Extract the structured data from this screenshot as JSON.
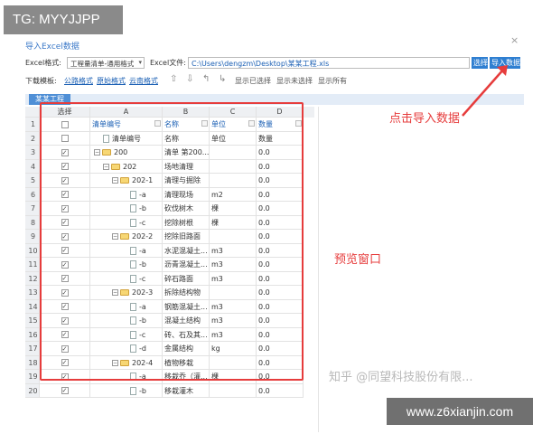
{
  "overlay": {
    "tg_label": "TG: MYYJJPP",
    "site_label": "www.z6xianjin.com",
    "watermark": "知乎 @同望科技股份有限..."
  },
  "dialog": {
    "title": "导入Excel数据",
    "close": "×",
    "excel_format_label": "Excel格式:",
    "excel_format_value": "工程量清单-通用格式",
    "excel_file_label": "Excel文件:",
    "excel_file_value": "C:\\Users\\dengzm\\Desktop\\某某工程.xls",
    "select_button": "选择",
    "import_button": "导入数据",
    "download_label": "下载模板:",
    "template_links": [
      "公路格式",
      "原始格式",
      "云南格式"
    ],
    "toolbar_buttons": [
      "显示已选择",
      "显示未选择",
      "显示所有"
    ],
    "sheet_tab": "某某工程"
  },
  "grid": {
    "col_headers": [
      "选择",
      "A",
      "B",
      "C",
      "D"
    ],
    "sub_headers": [
      "清单编号",
      "名称",
      "单位",
      "数量"
    ],
    "rows": [
      {
        "n": "1",
        "check": false,
        "level": 0,
        "kind": "header",
        "a": "",
        "b": "",
        "c": "",
        "d": ""
      },
      {
        "n": "2",
        "check": false,
        "level": 0,
        "kind": "file",
        "a": "清单编号",
        "b": "名称",
        "c": "单位",
        "d": "数量"
      },
      {
        "n": "3",
        "check": true,
        "level": 0,
        "kind": "folder",
        "a": "200",
        "b": "清单 第200...",
        "c": "",
        "d": "0.0"
      },
      {
        "n": "4",
        "check": true,
        "level": 1,
        "kind": "folder",
        "a": "202",
        "b": "场地清理",
        "c": "",
        "d": "0.0"
      },
      {
        "n": "5",
        "check": true,
        "level": 2,
        "kind": "folder",
        "a": "202-1",
        "b": "清理与掘除",
        "c": "",
        "d": "0.0"
      },
      {
        "n": "6",
        "check": true,
        "level": 3,
        "kind": "file",
        "a": "-a",
        "b": "清理现场",
        "c": "m2",
        "d": "0.0"
      },
      {
        "n": "7",
        "check": true,
        "level": 3,
        "kind": "file",
        "a": "-b",
        "b": "砍伐树木",
        "c": "棵",
        "d": "0.0"
      },
      {
        "n": "8",
        "check": true,
        "level": 3,
        "kind": "file",
        "a": "-c",
        "b": "挖除树根",
        "c": "棵",
        "d": "0.0"
      },
      {
        "n": "9",
        "check": true,
        "level": 2,
        "kind": "folder",
        "a": "202-2",
        "b": "挖除旧路面",
        "c": "",
        "d": "0.0"
      },
      {
        "n": "10",
        "check": true,
        "level": 3,
        "kind": "file",
        "a": "-a",
        "b": "水泥混凝土...",
        "c": "m3",
        "d": "0.0"
      },
      {
        "n": "11",
        "check": true,
        "level": 3,
        "kind": "file",
        "a": "-b",
        "b": "沥青混凝土...",
        "c": "m3",
        "d": "0.0"
      },
      {
        "n": "12",
        "check": true,
        "level": 3,
        "kind": "file",
        "a": "-c",
        "b": "碎石路面",
        "c": "m3",
        "d": "0.0"
      },
      {
        "n": "13",
        "check": true,
        "level": 2,
        "kind": "folder",
        "a": "202-3",
        "b": "拆除结构物",
        "c": "",
        "d": "0.0"
      },
      {
        "n": "14",
        "check": true,
        "level": 3,
        "kind": "file",
        "a": "-a",
        "b": "钢筋混凝土...",
        "c": "m3",
        "d": "0.0"
      },
      {
        "n": "15",
        "check": true,
        "level": 3,
        "kind": "file",
        "a": "-b",
        "b": "混凝土结构",
        "c": "m3",
        "d": "0.0"
      },
      {
        "n": "16",
        "check": true,
        "level": 3,
        "kind": "file",
        "a": "-c",
        "b": "砖、石及其...",
        "c": "m3",
        "d": "0.0"
      },
      {
        "n": "17",
        "check": true,
        "level": 3,
        "kind": "file",
        "a": "-d",
        "b": "金属结构",
        "c": "kg",
        "d": "0.0"
      },
      {
        "n": "18",
        "check": true,
        "level": 2,
        "kind": "folder",
        "a": "202-4",
        "b": "植物移栽",
        "c": "",
        "d": "0.0"
      },
      {
        "n": "19",
        "check": true,
        "level": 3,
        "kind": "file",
        "a": "-a",
        "b": "移栽乔（灌...",
        "c": "棵",
        "d": "0.0"
      },
      {
        "n": "20",
        "check": true,
        "level": 3,
        "kind": "file",
        "a": "-b",
        "b": "移栽灌木",
        "c": "",
        "d": "0.0"
      }
    ]
  },
  "annotations": {
    "import_hint": "点击导入数据",
    "preview_hint": "预览窗口",
    "color": "#e63c3c"
  }
}
